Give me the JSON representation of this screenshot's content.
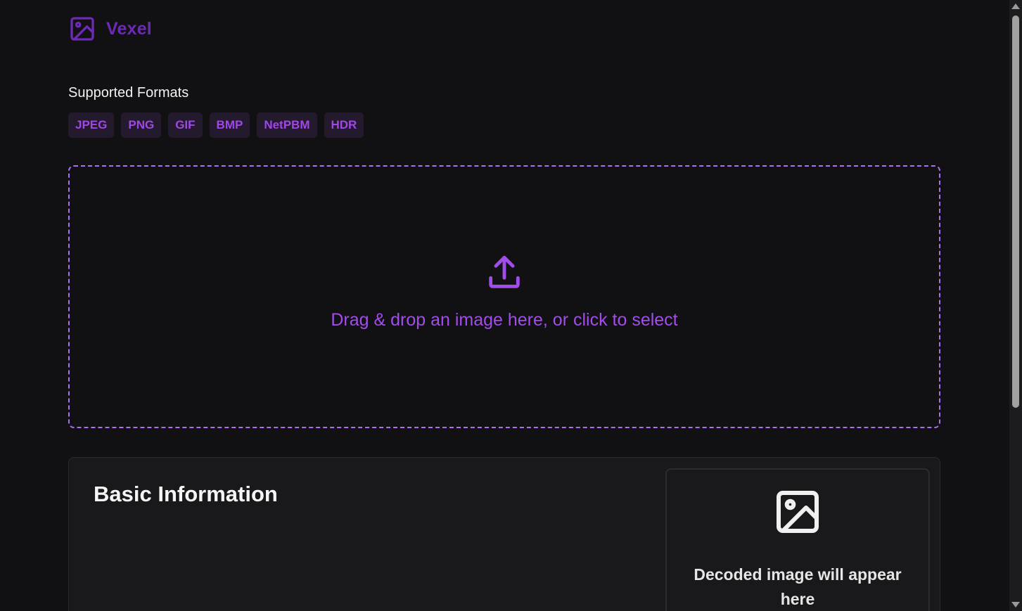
{
  "header": {
    "brand_name": "Vexel",
    "brand_icon": "image-icon",
    "accent_color": "#6b2bb3"
  },
  "formats": {
    "title": "Supported Formats",
    "items": [
      "JPEG",
      "PNG",
      "GIF",
      "BMP",
      "NetPBM",
      "HDR"
    ],
    "chip_text_color": "#a047e6"
  },
  "dropzone": {
    "icon": "upload-icon",
    "text": "Drag & drop an image here, or click to select",
    "border_color": "#b06ff0"
  },
  "info": {
    "title": "Basic Information",
    "preview_icon": "image-icon",
    "preview_text": "Decoded image will appear here"
  },
  "scrollbar": {
    "scrolled_fraction": 0.0
  }
}
